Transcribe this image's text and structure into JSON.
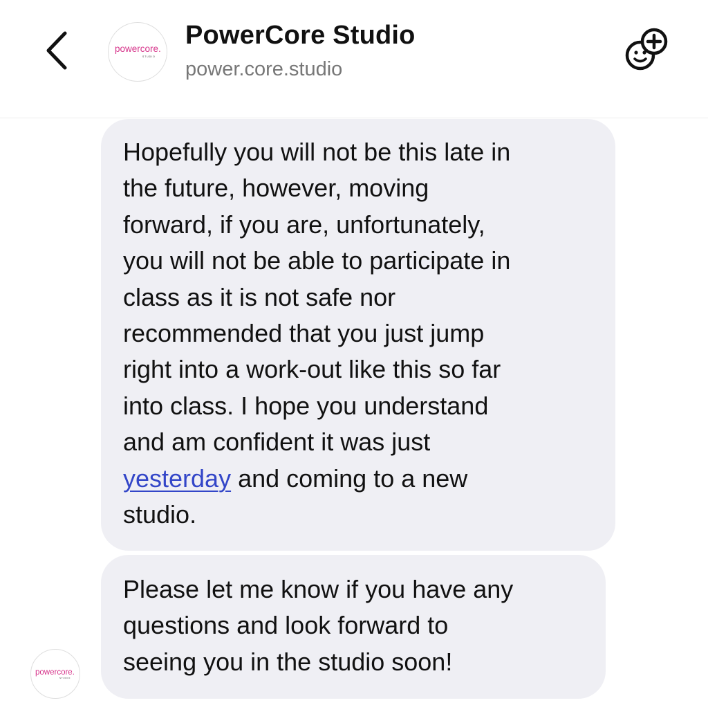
{
  "header": {
    "back_icon": "chevron-left-icon",
    "title": "PowerCore Studio",
    "username": "power.core.studio",
    "avatar_logo": "powercore.",
    "avatar_logo_sub": "STUDIO",
    "add_people_icon": "add-people-icon"
  },
  "messages": [
    {
      "lines": [
        "Hopefully you will not be this late in",
        "the future, however, moving",
        "forward, if you are, unfortunately,",
        "you will not be able to participate in",
        "class as it is not safe nor",
        "recommended that you just jump",
        "right into a work-out like this so far",
        "into class.   I hope you understand",
        "and am confident it was just"
      ],
      "link_text": "yesterday",
      "after_link": " and coming to a new",
      "last_line": "studio."
    },
    {
      "lines": [
        "Please let me know if you have any",
        "questions and look forward to",
        "seeing you in the studio soon!"
      ],
      "avatar_logo": "powercore.",
      "avatar_logo_sub": "STUDIO"
    }
  ],
  "colors": {
    "bubble": "#efeff4",
    "link": "#3346c8",
    "logo_pink": "#d6338a",
    "subtitle": "#777777"
  }
}
